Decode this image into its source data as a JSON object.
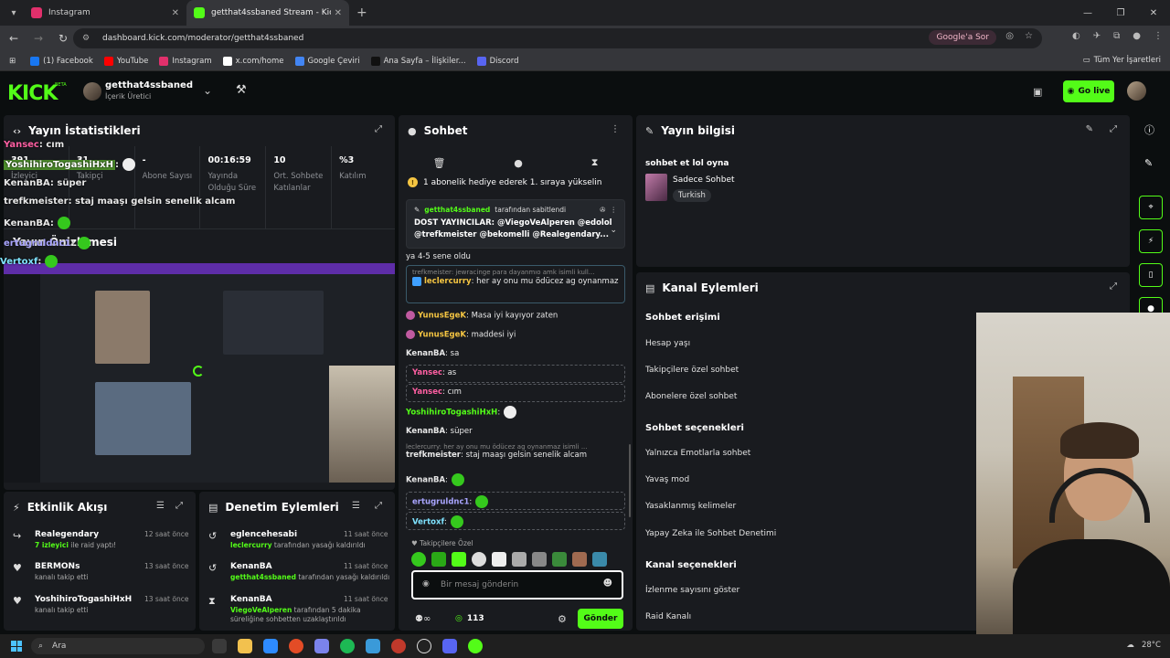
{
  "browser": {
    "tabs": [
      {
        "title": "Instagram",
        "color": "#e1306c",
        "active": false
      },
      {
        "title": "getthat4ssbaned Stream - Kick",
        "color": "#53fc18",
        "active": true
      }
    ],
    "url": "dashboard.kick.com/moderator/getthat4ssbaned",
    "google_sor": "Google'a Sor",
    "bookmarks": [
      {
        "label": "(1) Facebook",
        "color": "#1877f2"
      },
      {
        "label": "YouTube",
        "color": "#ff0000"
      },
      {
        "label": "Instagram",
        "color": "#e1306c"
      },
      {
        "label": "x.com/home",
        "color": "#ffffff"
      },
      {
        "label": "Google Çeviri",
        "color": "#4285f4"
      },
      {
        "label": "Ana Sayfa – İlişkiler...",
        "color": "#222222"
      },
      {
        "label": "Discord",
        "color": "#5865f2"
      }
    ],
    "all_bookmarks": "Tüm Yer İşaretleri"
  },
  "header": {
    "logo": "KICK",
    "beta": "BETA",
    "channel_name": "getthat4ssbaned",
    "channel_role": "İçerik Üretici",
    "go_live": "Go live"
  },
  "stats": {
    "title": "Yayın İstatistikleri",
    "items": [
      {
        "value": "391",
        "label": "İzleyici"
      },
      {
        "value": "31",
        "label": "Takipçi"
      },
      {
        "value": "-",
        "label": "Abone Sayısı"
      },
      {
        "value": "00:16:59",
        "label": "Yayında Olduğu Süre"
      },
      {
        "value": "10",
        "label": "Ort. Sohbete Katılanlar"
      },
      {
        "value": "%3",
        "label": "Katılım"
      }
    ]
  },
  "overlay_chat": [
    {
      "user": "Yansec",
      "text": ": cım",
      "color": "#ff5fa2"
    },
    {
      "user": "YoshihiroTogashiHxH",
      "text": ":",
      "color": "#ffffff",
      "highlight": true
    },
    {
      "user": "KenanBA",
      "text": ": süper",
      "color": "#ffffff"
    },
    {
      "user": "trefkmeister",
      "text": ": staj maaşı gelsin senelik alcam",
      "color": "#ffffff"
    },
    {
      "user": "KenanBA",
      "text": ":",
      "color": "#ffffff"
    },
    {
      "user": "ertugruldnc1",
      "text": ":",
      "color": "#a9a5ff"
    },
    {
      "user": "Vertoxf",
      "text": ":",
      "color": "#7fe3ff"
    }
  ],
  "preview": {
    "title": "Yayın Önizlemesi"
  },
  "activity": {
    "title": "Etkinlik Akışı",
    "items": [
      {
        "name": "Realegendary",
        "sub_hl": "7 izleyici",
        "sub": " ile raid yaptı!",
        "time": "12 saat önce",
        "icon": "↪"
      },
      {
        "name": "BERMONs",
        "sub_hl": "",
        "sub": "kanalı takip etti",
        "time": "13 saat önce",
        "icon": "♥"
      },
      {
        "name": "YoshihiroTogashiHxH",
        "sub_hl": "",
        "sub": "kanalı takip etti",
        "time": "13 saat önce",
        "icon": "♥"
      }
    ]
  },
  "moderation": {
    "title": "Denetim Eylemleri",
    "items": [
      {
        "name": "eglencehesabi",
        "sub_hl": "leclercurry",
        "sub": " tarafından yasağı kaldırıldı",
        "time": "11 saat önce",
        "icon": "↺"
      },
      {
        "name": "KenanBA",
        "sub_hl": "getthat4ssbaned",
        "sub": " tarafından yasağı kaldırıldı",
        "time": "11 saat önce",
        "icon": "↺"
      },
      {
        "name": "KenanBA",
        "sub_hl": "ViegoVeAlperen",
        "sub": " tarafından 5 dakika süreliğine sohbetten uzaklaştırıldı",
        "time": "11 saat önce",
        "icon": "⧗"
      }
    ]
  },
  "chat": {
    "title": "Sohbet",
    "gift_banner": "1 abonelik hediye ederek 1. sıraya yükselin",
    "pinned_by_user": "getthat4ssbaned",
    "pinned_by_suffix": "tarafından sabitlendi",
    "pinned_text": "DOST YAYINCILAR: @ViegoVeAlperen @edolol @trefkmeister @bekomelli @Realegendary...",
    "messages": [
      {
        "user": "",
        "text": "ya 4-5 sene oldu",
        "color": "#ffffff",
        "boxed": false,
        "emote": false
      },
      {
        "user": "leclercurry",
        "text": ": her ay onu mu ödücez ag oynanmaz",
        "color": "#f5c542",
        "boxed": true,
        "emote": false,
        "reply": "trefkmeister: jewracinge para dayanmıo amk isimli kull..."
      },
      {
        "user": "YunusEgeK",
        "text": ": Masa iyi kayıyor zaten",
        "color": "#f5c542",
        "boxed": false,
        "emote": false
      },
      {
        "user": "YunusEgeK",
        "text": ": maddesi iyi",
        "color": "#f5c542",
        "boxed": false,
        "emote": false
      },
      {
        "user": "KenanBA",
        "text": ": sa",
        "color": "#ffffff",
        "boxed": false,
        "emote": false
      },
      {
        "user": "Yansec",
        "text": ": as",
        "color": "#ff5fa2",
        "boxed": true,
        "emote": false
      },
      {
        "user": "Yansec",
        "text": ": cım",
        "color": "#ff5fa2",
        "boxed": true,
        "emote": false
      },
      {
        "user": "YoshihiroTogashiHxH",
        "text": ":",
        "color": "#53fc18",
        "boxed": false,
        "emote": true
      },
      {
        "user": "KenanBA",
        "text": ": süper",
        "color": "#ffffff",
        "boxed": false,
        "emote": false
      },
      {
        "user": "trefkmeister",
        "text": ": staj maaşı gelsin senelik alcam",
        "color": "#ffffff",
        "boxed": false,
        "emote": false,
        "reply": "leclercurry: her ay onu mu ödücez ag oynanmaz isimli ..."
      },
      {
        "user": "KenanBA",
        "text": ":",
        "color": "#ffffff",
        "boxed": false,
        "emote": true
      },
      {
        "user": "ertugruldnc1",
        "text": ":",
        "color": "#a9a5ff",
        "boxed": true,
        "emote": true
      },
      {
        "user": "Vertoxf",
        "text": ":",
        "color": "#7fe3ff",
        "boxed": true,
        "emote": true
      }
    ],
    "emote_label": "Takipçilere Özel",
    "placeholder": "Bir mesaj gönderin",
    "points": "113",
    "send": "Gönder"
  },
  "stream_info": {
    "title": "Yayın bilgisi",
    "stream_title": "sohbet et lol oyna",
    "category": "Sadece Sohbet",
    "language": "Turkish"
  },
  "channel_actions": {
    "title": "Kanal Eylemleri",
    "sections": [
      {
        "heading": "Sohbet erişimi",
        "items": [
          "Hesap yaşı",
          "Takipçilere özel sohbet",
          "Abonelere özel sohbet"
        ]
      },
      {
        "heading": "Sohbet seçenekleri",
        "items": [
          "Yalnızca Emotlarla sohbet",
          "Yavaş mod",
          "Yasaklanmış kelimeler",
          "Yapay Zeka ile Sohbet Denetimi"
        ]
      },
      {
        "heading": "Kanal seçenekleri",
        "items": [
          "İzlenme sayısını göster",
          "Raid Kanalı"
        ]
      }
    ]
  },
  "taskbar": {
    "search": "Ara",
    "weather": "28°C"
  },
  "colors": {
    "accent": "#53fc18",
    "panel": "#191b1f",
    "bg": "#0b0e0f"
  }
}
